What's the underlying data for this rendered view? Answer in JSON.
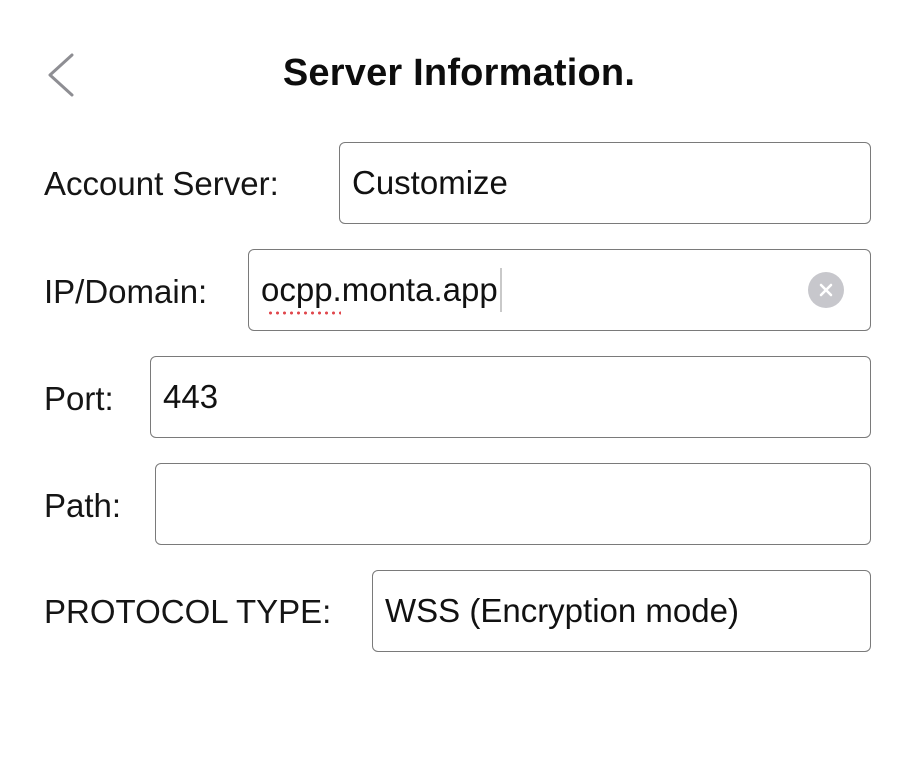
{
  "header": {
    "title": "Server Information.",
    "back_icon": "chevron-left-icon"
  },
  "form": {
    "account_server": {
      "label": "Account Server:",
      "value": "Customize"
    },
    "ip_domain": {
      "label": "IP/Domain:",
      "value": "ocpp.monta.app",
      "clear_icon": "clear-circle-icon"
    },
    "port": {
      "label": "Port:",
      "value": "443"
    },
    "path": {
      "label": "Path:",
      "value": ""
    },
    "protocol_type": {
      "label": "PROTOCOL TYPE:",
      "value": "WSS (Encryption mode)"
    }
  },
  "colors": {
    "field_border": "#7a7a7a",
    "spellcheck_underline": "#e0474c",
    "clear_button": "#c7c7cc",
    "back_chevron": "#8e8e93"
  }
}
